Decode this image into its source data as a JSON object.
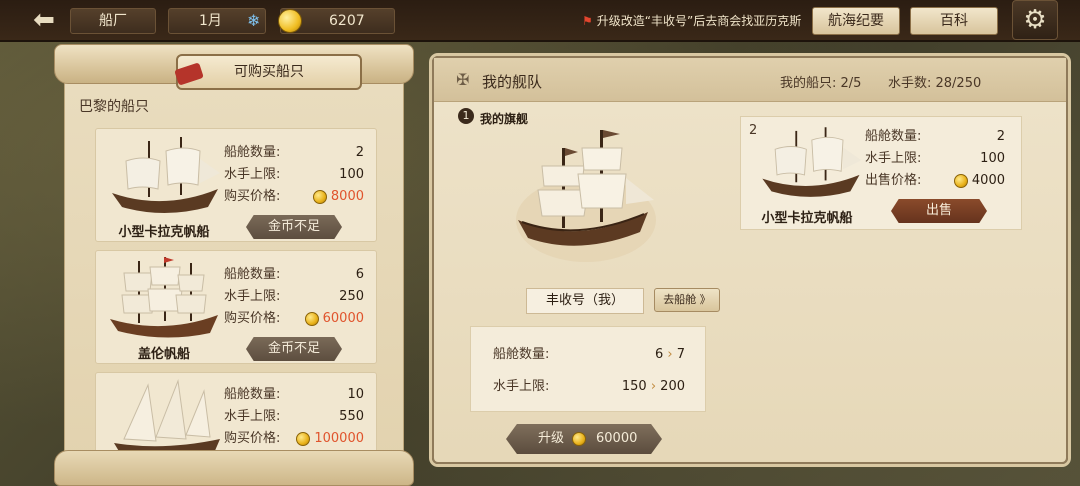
{
  "topbar": {
    "location": "船厂",
    "month": "1月",
    "gold": "6207",
    "quest": "升级改造“丰收号”后去商会找亚历克斯",
    "log_label": "航海纪要",
    "wiki_label": "百科"
  },
  "shop": {
    "title": "可购买船只",
    "city_label": "巴黎的船只",
    "ships": [
      {
        "name": "小型卡拉克帆船",
        "cabins_label": "船舱数量:",
        "cabins": "2",
        "crew_label": "水手上限:",
        "crew": "100",
        "price_label": "购买价格:",
        "price": "8000",
        "button": "金币不足"
      },
      {
        "name": "盖伦帆船",
        "cabins_label": "船舱数量:",
        "cabins": "6",
        "crew_label": "水手上限:",
        "crew": "250",
        "price_label": "购买价格:",
        "price": "60000",
        "button": "金币不足"
      },
      {
        "name": "",
        "cabins_label": "船舱数量:",
        "cabins": "10",
        "crew_label": "水手上限:",
        "crew": "550",
        "price_label": "购买价格:",
        "price": "100000",
        "button": ""
      }
    ]
  },
  "fleet": {
    "title": "我的舰队",
    "ship_count": "我的船只: 2/5",
    "crew_count": "水手数: 28/250",
    "flagship": {
      "index": "1",
      "label": "我的旗舰",
      "name": "丰收号（我）",
      "cabin_button": "去船舱 》",
      "cabins_label": "船舱数量:",
      "cabins_from": "6",
      "cabins_to": "7",
      "crew_label": "水手上限:",
      "crew_from": "150",
      "crew_to": "200",
      "upgrade_label": "升级",
      "upgrade_price": "60000"
    },
    "owned": {
      "index": "2",
      "name": "小型卡拉克帆船",
      "cabins_label": "船舱数量:",
      "cabins": "2",
      "crew_label": "水手上限:",
      "crew": "100",
      "sell_price_label": "出售价格:",
      "sell_price": "4000",
      "sell_button": "出售"
    }
  },
  "icons": [
    "back-arrow-icon",
    "snowflake-icon",
    "gold-coin-icon",
    "flag-icon",
    "gear-icon",
    "fleet-icon"
  ],
  "colors": {
    "price_insufficient": "#e0542d",
    "sell_button": "#7a3f24"
  }
}
